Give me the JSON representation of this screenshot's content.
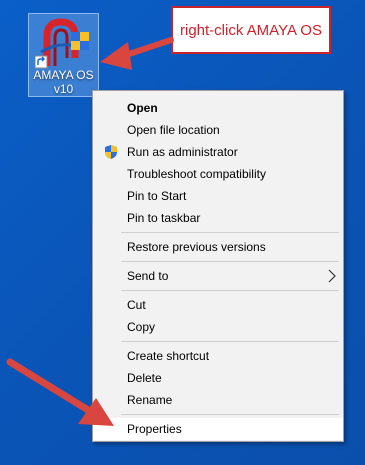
{
  "desktop": {
    "icon": {
      "label_line1": "AMAYA OS",
      "label_line2": "v10",
      "icon_name": "amaya-os-app-icon"
    }
  },
  "callout": {
    "text": "right-click AMAYA OS",
    "color": "#d3202a"
  },
  "context_menu": {
    "items": [
      {
        "label": "Open",
        "bold": true
      },
      {
        "label": "Open file location"
      },
      {
        "label": "Run as administrator",
        "icon": "uac-shield-icon"
      },
      {
        "label": "Troubleshoot compatibility"
      },
      {
        "label": "Pin to Start"
      },
      {
        "label": "Pin to taskbar"
      },
      {
        "label": "Restore previous versions"
      },
      {
        "label": "Send to",
        "submenu": true
      },
      {
        "label": "Cut"
      },
      {
        "label": "Copy"
      },
      {
        "label": "Create shortcut"
      },
      {
        "label": "Delete"
      },
      {
        "label": "Rename"
      },
      {
        "label": "Properties",
        "highlighted": true
      }
    ]
  },
  "colors": {
    "desktop_bg": "#0a55b8",
    "annotation_red": "#d9453f",
    "menu_bg": "#f2f2f2"
  }
}
